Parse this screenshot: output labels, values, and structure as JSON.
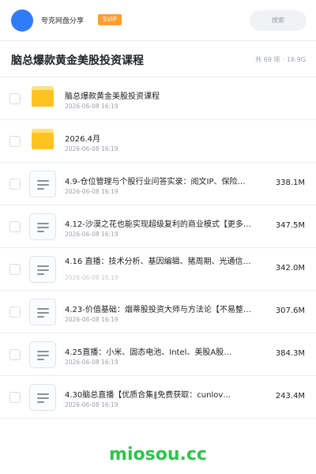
{
  "header": {
    "user_name": "夸克网盘分享",
    "badge": "SVIP",
    "search_placeholder": "搜索",
    "avatar_color": "#2f7cf6",
    "badge_color": "#ff9d2e"
  },
  "folder": {
    "title": "脑总爆款黄金美股投资课程",
    "count_label": "共 69 项",
    "separator": "·",
    "total_size": "16.9G"
  },
  "items": [
    {
      "type": "folder",
      "name": "脑总爆款黄金美股投资课程",
      "date": "2026-06-08 16:19",
      "size": ""
    },
    {
      "type": "folder",
      "name": "2026.4月",
      "date": "2026-06-08 16:19",
      "size": ""
    },
    {
      "type": "file",
      "name": "4.9-仓位管理与个股行业问答实录：阅文IP、保险…",
      "date": "2026-06-08 16:19",
      "size": "338.1M"
    },
    {
      "type": "file",
      "name": "4.12-沙漠之花也能实现超级复利的商业模式【更多…",
      "date": "2026-06-08 16:19",
      "size": "347.5M"
    },
    {
      "type": "file",
      "name": "4.16 直播：技术分析、基因编辑、猪周期、光通信…",
      "date": "2026-06-08 16:19",
      "size": "342.0M"
    },
    {
      "type": "file",
      "name": "4.23-价值基础：烟蒂股投资大师与方法论【不易整…",
      "date": "2026-06-08 16:19",
      "size": "307.6M"
    },
    {
      "type": "file",
      "name": "4.25直播：小米、固态电池、Intel、美股A股…",
      "date": "2026-06-08 16:19",
      "size": "384.3M"
    },
    {
      "type": "file",
      "name": "4.30脑总直播【优质合集‖免费获取：cunlov…",
      "date": "2026-06-08 16:19",
      "size": "243.4M"
    }
  ],
  "watermark": "miosou.cc",
  "colors": {
    "folder": "#ffc31f",
    "watermark": "#2fc34a",
    "divider": "#eceef2"
  }
}
